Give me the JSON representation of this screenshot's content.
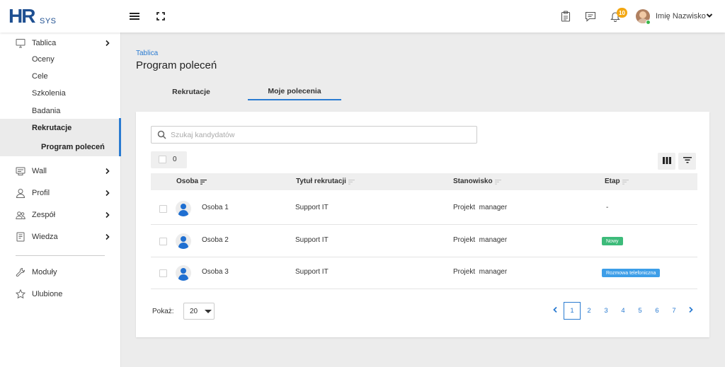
{
  "logo": {
    "primary": "HR",
    "secondary": "SYS"
  },
  "topbar": {
    "notifications_count": "10",
    "user_name": "Imię Nazwisko"
  },
  "sidebar": {
    "items": [
      {
        "label": "Tablica",
        "icon": "monitor-icon"
      },
      {
        "label": "Oceny"
      },
      {
        "label": "Cele"
      },
      {
        "label": "Szkolenia"
      },
      {
        "label": "Badania"
      },
      {
        "label": "Rekrutacje"
      },
      {
        "label": "Program poleceń"
      },
      {
        "label": "Wall",
        "icon": "wall-icon"
      },
      {
        "label": "Profil",
        "icon": "person-icon"
      },
      {
        "label": "Zespół",
        "icon": "team-icon"
      },
      {
        "label": "Wiedza",
        "icon": "book-icon"
      },
      {
        "label": "Moduły",
        "icon": "wrench-icon"
      },
      {
        "label": "Ulubione",
        "icon": "star-icon"
      }
    ]
  },
  "main": {
    "breadcrumb": "Tablica",
    "title": "Program poleceń",
    "tabs": [
      {
        "label": "Rekrutacje",
        "active": false
      },
      {
        "label": "Moje polecenia",
        "active": true
      }
    ],
    "search": {
      "placeholder": "Szukaj kandydatów",
      "value": ""
    },
    "selected_count": "0",
    "table": {
      "columns": [
        "Osoba",
        "Tytuł rekrutacji",
        "Stanowisko",
        "Etap"
      ],
      "rows": [
        {
          "osoba": "Osoba 1",
          "tytul": "Support IT",
          "stanowisko": "Projekt  manager",
          "etap": "-"
        },
        {
          "osoba": "Osoba 2",
          "tytul": "Support IT",
          "stanowisko": "Projekt  manager",
          "etap": "Nowy",
          "etap_color": "#3dbb7a"
        },
        {
          "osoba": "Osoba 3",
          "tytul": "Support IT",
          "stanowisko": "Projekt  manager",
          "etap": "Rozmowa telefoniczna",
          "etap_color": "#3d9ee8"
        }
      ]
    },
    "pagination": {
      "show_label": "Pokaż:",
      "page_size": "20",
      "pages": [
        "1",
        "2",
        "3",
        "4",
        "5",
        "6",
        "7"
      ],
      "current": "1"
    }
  },
  "colors": {
    "accent": "#2a7bd1",
    "brand": "#1e4f91",
    "badge": "#f3a712"
  }
}
